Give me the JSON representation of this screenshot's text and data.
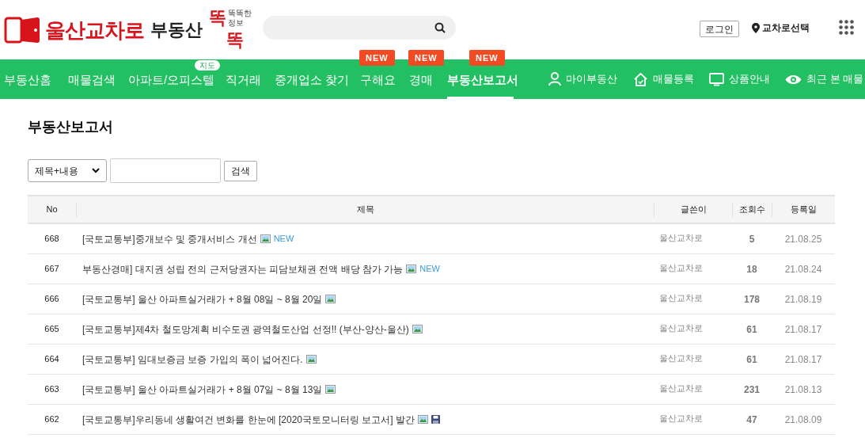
{
  "logo": {
    "brand": "울산교차로",
    "section": "부동산",
    "mark_top": "똑",
    "mark_bottom": "똑",
    "tagline": "똑똑한 정보"
  },
  "header": {
    "login": "로그인",
    "location": "교차로선택"
  },
  "nav": [
    {
      "label": "부동산홈",
      "selected": false
    },
    {
      "label": "매물검색",
      "selected": false
    },
    {
      "label": "아파트/오피스텔",
      "selected": false,
      "badge": {
        "text": "지도",
        "kind": "map"
      }
    },
    {
      "label": "직거래",
      "selected": false
    },
    {
      "label": "중개업소 찾기",
      "selected": false
    },
    {
      "label": "구해요",
      "selected": false,
      "badge": {
        "text": "NEW",
        "kind": "new"
      }
    },
    {
      "label": "경매",
      "selected": false,
      "badge": {
        "text": "NEW",
        "kind": "new"
      }
    },
    {
      "label": "부동산보고서",
      "selected": true,
      "badge": {
        "text": "NEW",
        "kind": "new"
      }
    }
  ],
  "nav_right": [
    {
      "label": "마이부동산",
      "kind": "person"
    },
    {
      "label": "매물등록",
      "kind": "house"
    },
    {
      "label": "상품안내",
      "kind": "monitor"
    },
    {
      "label": "최근 본 매물",
      "kind": "eye"
    }
  ],
  "page_title": "부동산보고서",
  "search": {
    "scope": "제목+내용",
    "button": "검색"
  },
  "table": {
    "columns": [
      "No",
      "제목",
      "글쓴이",
      "조회수",
      "등록일"
    ],
    "rows": [
      {
        "no": "668",
        "title": "[국토교통부]중개보수 및 중개서비스 개선",
        "image": true,
        "file": false,
        "new": "NEW",
        "author": "울산교차로",
        "views": "5",
        "date": "21.08.25"
      },
      {
        "no": "667",
        "title": "부동산경매] 대지권 성립 전의 근저당권자는 피담보채권 전액 배당 참가 가능",
        "image": true,
        "file": false,
        "new": "NEW",
        "author": "울산교차로",
        "views": "18",
        "date": "21.08.24"
      },
      {
        "no": "666",
        "title": "[국토교통부] 울산 아파트실거래가 + 8월 08일 ~ 8월 20일",
        "image": true,
        "file": false,
        "author": "울산교차로",
        "views": "178",
        "date": "21.08.19"
      },
      {
        "no": "665",
        "title": "[국토교통부]제4차 철도망계획 비수도권 광역철도산업 선정!! (부산-양산-울산)",
        "image": true,
        "file": false,
        "author": "울산교차로",
        "views": "61",
        "date": "21.08.17"
      },
      {
        "no": "664",
        "title": "[국토교통부] 임대보증금 보증 가입의 폭이 넓어진다.",
        "image": true,
        "file": false,
        "author": "울산교차로",
        "views": "61",
        "date": "21.08.17"
      },
      {
        "no": "663",
        "title": "[국토교통부] 울산 아파트실거래가 + 8월 07일 ~ 8월 13일",
        "image": true,
        "file": false,
        "author": "울산교차로",
        "views": "231",
        "date": "21.08.13"
      },
      {
        "no": "662",
        "title": "[국토교통부]우리동네 생활여건 변화를 한눈에 [2020국토모니터링 보고서] 발간",
        "image": true,
        "file": true,
        "author": "울산교차로",
        "views": "47",
        "date": "21.08.09"
      }
    ]
  }
}
